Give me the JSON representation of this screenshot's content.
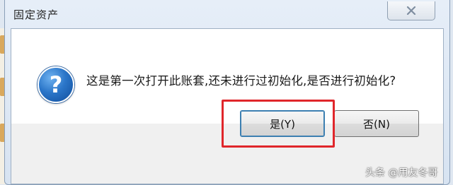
{
  "dialog": {
    "title": "固定资产",
    "message": "这是第一次打开此账套,还未进行过初始化,是否进行初始化?",
    "icon": "question-icon",
    "buttons": {
      "yes_label": "是(Y)",
      "no_label": "否(N)"
    }
  },
  "titlebar": {
    "close_icon": "close-icon"
  },
  "watermark": {
    "text": "头条 @用友冬哥"
  },
  "colors": {
    "highlight": "#e0262b",
    "accent": "#3c7fb1"
  }
}
